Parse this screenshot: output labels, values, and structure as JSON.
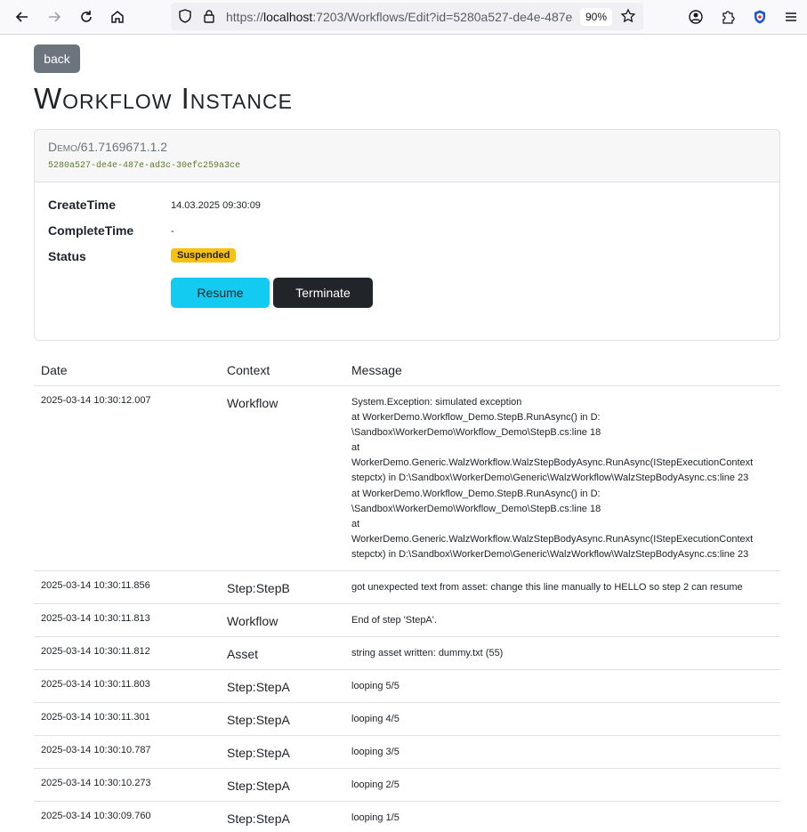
{
  "browser": {
    "url_prefix": "https://",
    "url_host": "localhost",
    "url_rest": ":7203/Workflows/Edit?id=5280a527-de4e-487e",
    "zoom": "90%"
  },
  "page": {
    "back_label": "back",
    "title": "Workflow Instance"
  },
  "instance": {
    "name": "Demo/61.7169671.1.2",
    "id": "5280a527-de4e-487e-ad3c-30efc259a3ce",
    "create_time_label": "CreateTime",
    "create_time": "14.03.2025 09:30:09",
    "complete_time_label": "CompleteTime",
    "complete_time": "-",
    "status_label": "Status",
    "status": "Suspended",
    "status_color": "#f7c114",
    "resume_label": "Resume",
    "terminate_label": "Terminate"
  },
  "log": {
    "headers": {
      "date": "Date",
      "context": "Context",
      "message": "Message"
    },
    "rows": [
      {
        "date": "2025-03-14 10:30:12.007",
        "context": "Workflow",
        "message": [
          "System.Exception: simulated exception",
          "at WorkerDemo.Workflow_Demo.StepB.RunAsync() in D:",
          "\\Sandbox\\WorkerDemo\\Workflow_Demo\\StepB.cs:line 18",
          "at",
          "WorkerDemo.Generic.WalzWorkflow.WalzStepBodyAsync.RunAsync(IStepExecutionContext",
          "stepctx) in D:\\Sandbox\\WorkerDemo\\Generic\\WalzWorkflow\\WalzStepBodyAsync.cs:line 23",
          "at WorkerDemo.Workflow_Demo.StepB.RunAsync() in D:",
          "\\Sandbox\\WorkerDemo\\Workflow_Demo\\StepB.cs:line 18",
          "at",
          "WorkerDemo.Generic.WalzWorkflow.WalzStepBodyAsync.RunAsync(IStepExecutionContext",
          "stepctx) in D:\\Sandbox\\WorkerDemo\\Generic\\WalzWorkflow\\WalzStepBodyAsync.cs:line 23"
        ]
      },
      {
        "date": "2025-03-14 10:30:11.856",
        "context": "Step:StepB",
        "message": [
          "got unexpected text from asset: change this line manually to HELLO so step 2 can resume"
        ]
      },
      {
        "date": "2025-03-14 10:30:11.813",
        "context": "Workflow",
        "message": [
          "End of step 'StepA'."
        ]
      },
      {
        "date": "2025-03-14 10:30:11.812",
        "context": "Asset",
        "message": [
          "string asset written: dummy.txt (55)"
        ]
      },
      {
        "date": "2025-03-14 10:30:11.803",
        "context": "Step:StepA",
        "message": [
          "looping 5/5"
        ]
      },
      {
        "date": "2025-03-14 10:30:11.301",
        "context": "Step:StepA",
        "message": [
          "looping 4/5"
        ]
      },
      {
        "date": "2025-03-14 10:30:10.787",
        "context": "Step:StepA",
        "message": [
          "looping 3/5"
        ]
      },
      {
        "date": "2025-03-14 10:30:10.273",
        "context": "Step:StepA",
        "message": [
          "looping 2/5"
        ]
      },
      {
        "date": "2025-03-14 10:30:09.760",
        "context": "Step:StepA",
        "message": [
          "looping 1/5"
        ]
      }
    ]
  }
}
